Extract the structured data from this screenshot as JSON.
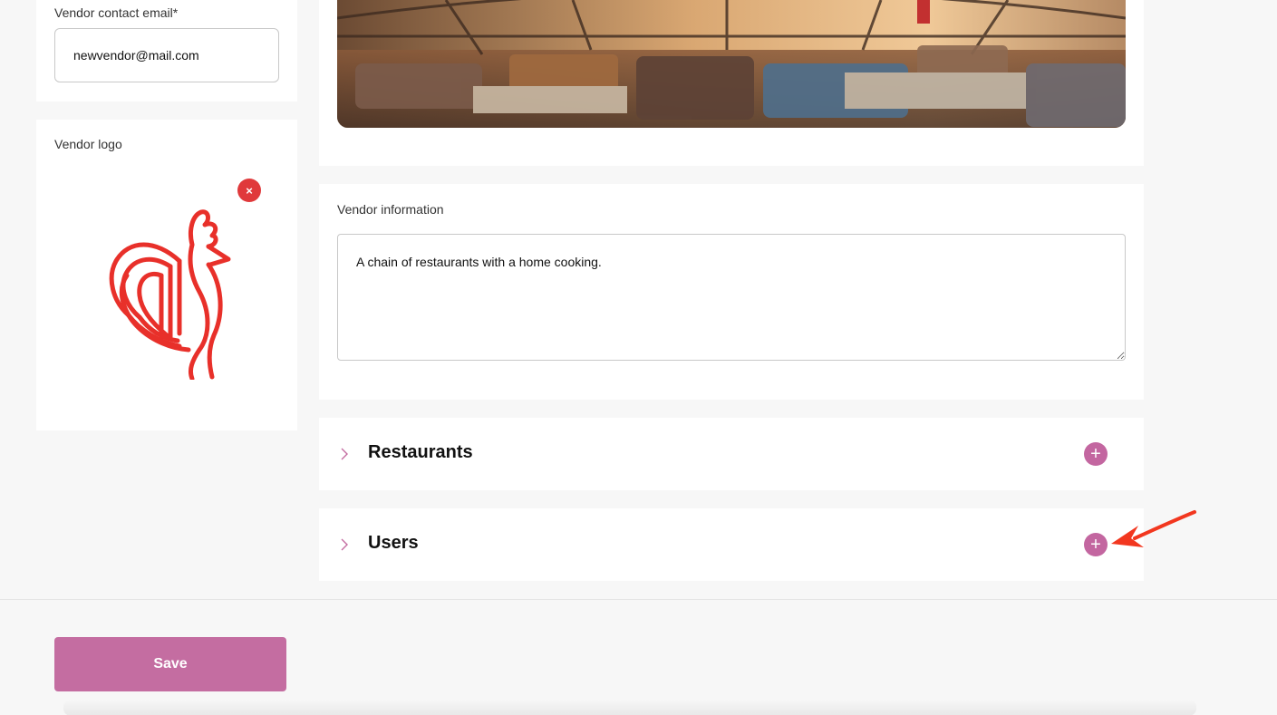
{
  "vendor_contact": {
    "label": "Vendor contact email*",
    "value": "newvendor@mail.com"
  },
  "vendor_logo": {
    "label": "Vendor logo",
    "remove_label": "×"
  },
  "vendor_information": {
    "label": "Vendor information",
    "value": "A chain of restaurants with a home cooking."
  },
  "sections": [
    {
      "title": "Restaurants",
      "add_label": "+"
    },
    {
      "title": "Users",
      "add_label": "+"
    }
  ],
  "footer": {
    "save_label": "Save"
  },
  "colors": {
    "accent": "#c46da1",
    "remove": "#e0393b",
    "logo": "#e8302a",
    "annotation_arrow": "#f2371f"
  },
  "icons": {
    "chevron": "chevron-right-icon",
    "add": "plus-circle-icon",
    "remove": "close-icon"
  }
}
